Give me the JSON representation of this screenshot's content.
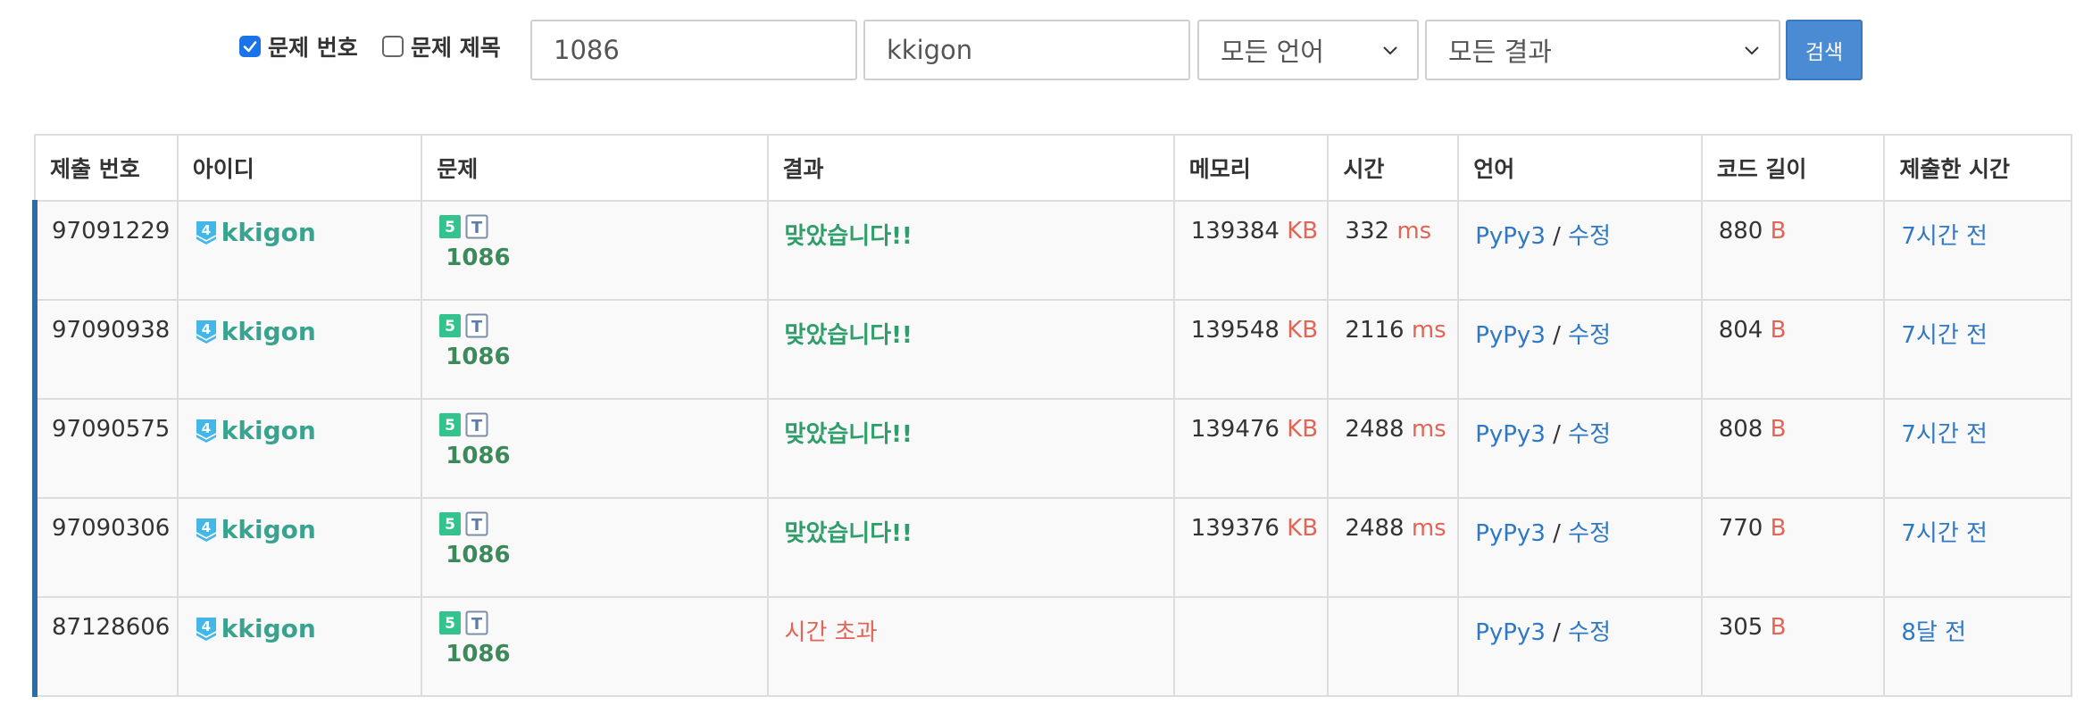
{
  "filters": {
    "problem_number": {
      "label": "문제 번호",
      "checked": true
    },
    "problem_title": {
      "label": "문제 제목",
      "checked": false
    },
    "problem_input": "1086",
    "user_input": "kkigon",
    "language_select": "모든 언어",
    "result_select": "모든 결과",
    "search_label": "검색"
  },
  "columns": [
    "제출 번호",
    "아이디",
    "문제",
    "결과",
    "메모리",
    "시간",
    "언어",
    "코드 길이",
    "제출한 시간"
  ],
  "units": {
    "memory": "KB",
    "time": "ms",
    "code": "B"
  },
  "edit_label": "수정",
  "slash": "/",
  "tier_badge": "4",
  "problem_badge": "5",
  "problem_type_badge": "T",
  "rows": [
    {
      "id": "97091229",
      "user": "kkigon",
      "problem": "1086",
      "result": "맞았습니다!!",
      "result_type": "ok",
      "memory": "139384",
      "time": "332",
      "lang": "PyPy3",
      "code_len": "880",
      "submitted": "7시간 전"
    },
    {
      "id": "97090938",
      "user": "kkigon",
      "problem": "1086",
      "result": "맞았습니다!!",
      "result_type": "ok",
      "memory": "139548",
      "time": "2116",
      "lang": "PyPy3",
      "code_len": "804",
      "submitted": "7시간 전"
    },
    {
      "id": "97090575",
      "user": "kkigon",
      "problem": "1086",
      "result": "맞았습니다!!",
      "result_type": "ok",
      "memory": "139476",
      "time": "2488",
      "lang": "PyPy3",
      "code_len": "808",
      "submitted": "7시간 전"
    },
    {
      "id": "97090306",
      "user": "kkigon",
      "problem": "1086",
      "result": "맞았습니다!!",
      "result_type": "ok",
      "memory": "139376",
      "time": "2488",
      "lang": "PyPy3",
      "code_len": "770",
      "submitted": "7시간 전"
    },
    {
      "id": "87128606",
      "user": "kkigon",
      "problem": "1086",
      "result": "시간 초과",
      "result_type": "tle",
      "memory": "",
      "time": "",
      "lang": "PyPy3",
      "code_len": "305",
      "submitted": "8달 전"
    }
  ],
  "colors": {
    "accent": "#2e6da4",
    "ok": "#2f9e6b",
    "error": "#e26555",
    "link": "#2f78c4",
    "user": "#3aa38f",
    "button": "#4a8bd4"
  }
}
